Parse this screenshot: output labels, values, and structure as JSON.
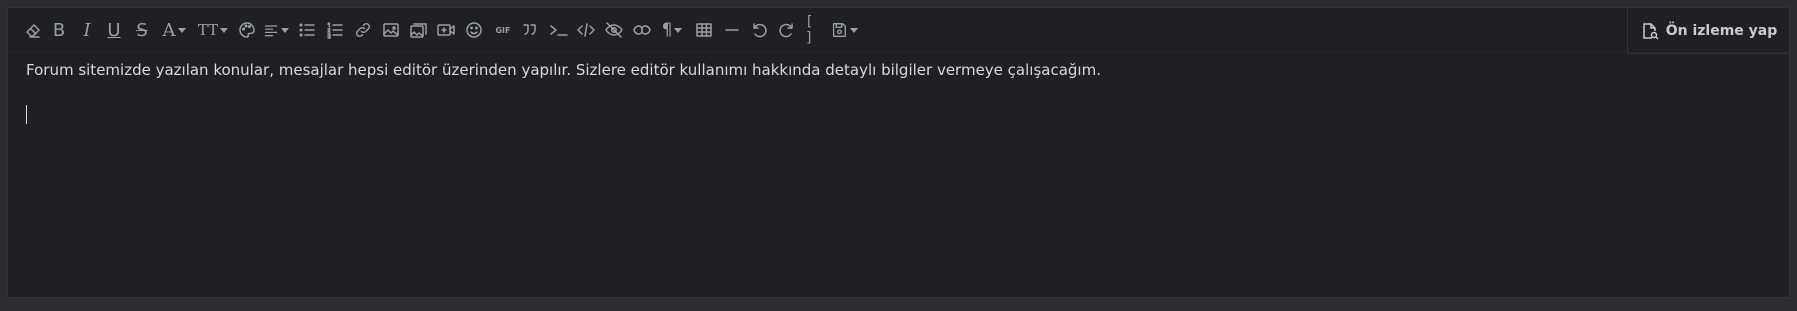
{
  "toolbar": {
    "buttons": [
      {
        "name": "remove-format-icon"
      },
      {
        "name": "bold-icon",
        "glyph": "B"
      },
      {
        "name": "italic-icon",
        "glyph": "I"
      },
      {
        "name": "underline-icon",
        "glyph": "U"
      },
      {
        "name": "strikethrough-icon",
        "glyph": "S"
      },
      {
        "name": "text-color-icon",
        "glyph": "A"
      },
      {
        "name": "font-size-icon",
        "glyph": "TT"
      },
      {
        "name": "palette-icon"
      },
      {
        "name": "align-icon"
      },
      {
        "name": "bullet-list-icon"
      },
      {
        "name": "numbered-list-icon"
      },
      {
        "name": "link-icon"
      },
      {
        "name": "image-icon"
      },
      {
        "name": "gallery-icon"
      },
      {
        "name": "video-icon"
      },
      {
        "name": "emoji-icon"
      },
      {
        "name": "gif-icon",
        "glyph": "GIF"
      },
      {
        "name": "quote-icon"
      },
      {
        "name": "code-inline-icon"
      },
      {
        "name": "code-icon"
      },
      {
        "name": "spoiler-icon"
      },
      {
        "name": "inline-spoiler-icon"
      },
      {
        "name": "paragraph-icon",
        "glyph": "¶"
      },
      {
        "name": "table-icon"
      },
      {
        "name": "horizontal-rule-icon"
      },
      {
        "name": "undo-icon"
      },
      {
        "name": "redo-icon"
      },
      {
        "name": "bbcode-icon",
        "glyph": "[ ]"
      },
      {
        "name": "drafts-icon"
      }
    ],
    "preview_label": "Ön izleme yap"
  },
  "editor": {
    "text": "Forum sitemizde yazılan konular, mesajlar hepsi editör üzerinden yapılır. Sizlere editör kullanımı hakkında detaylı bilgiler vermeye çalışacağım."
  }
}
